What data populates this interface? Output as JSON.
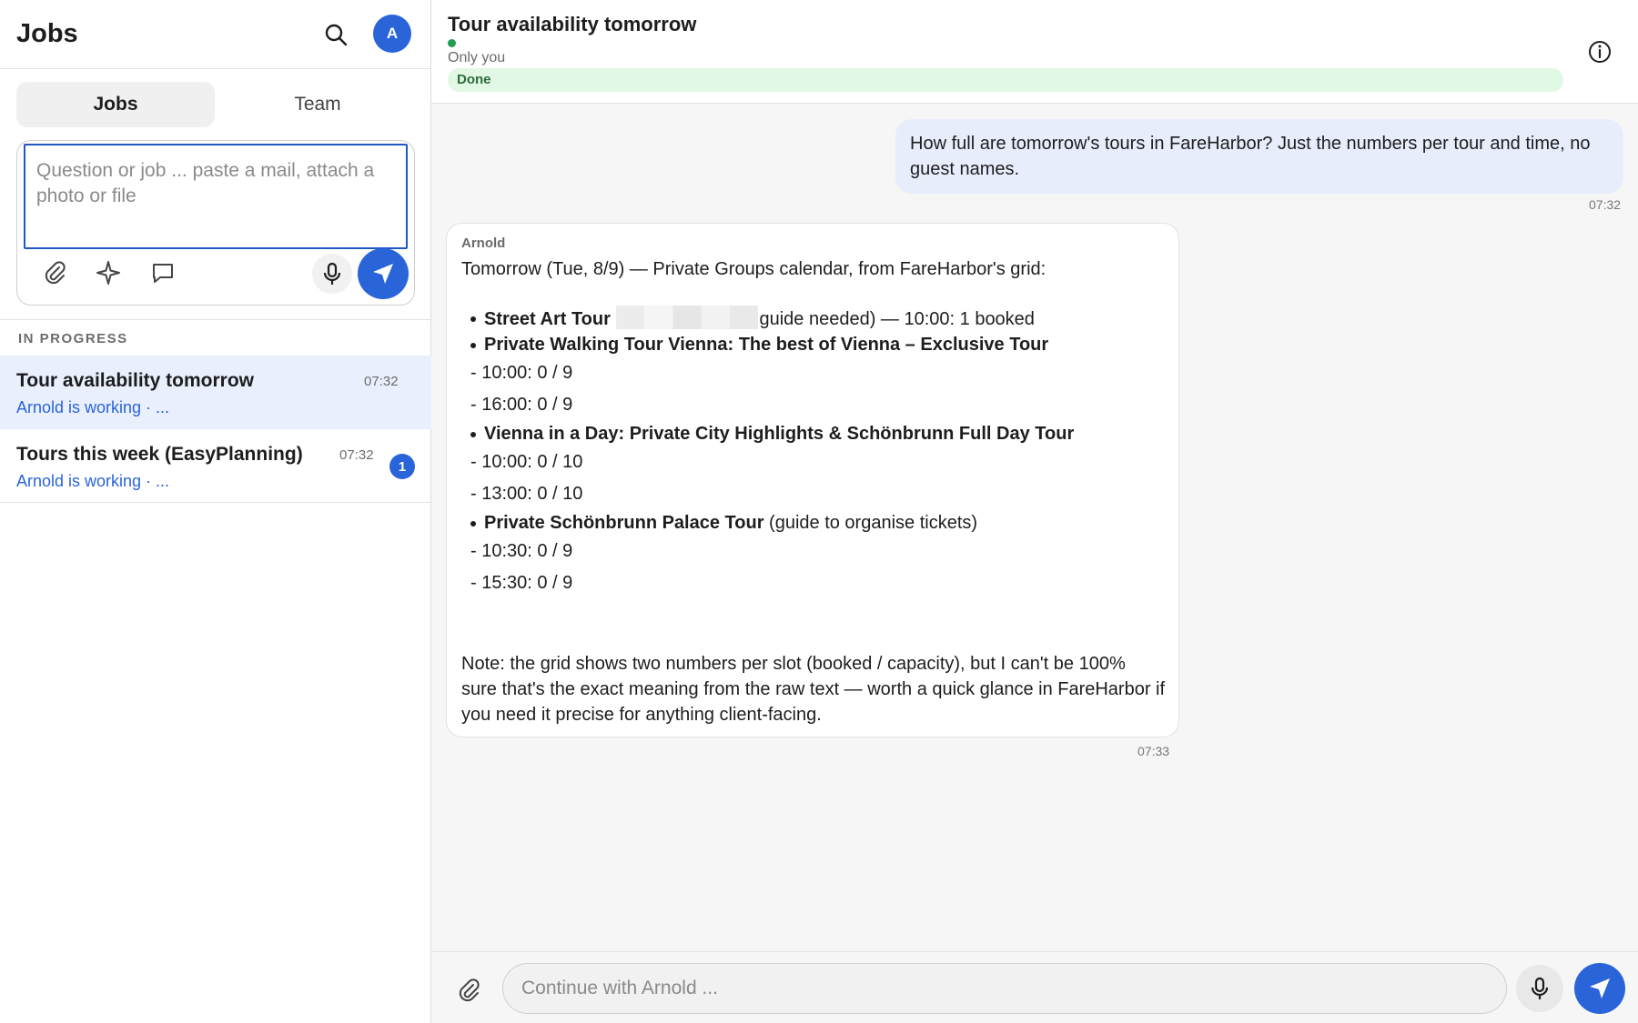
{
  "colors": {
    "accent": "#2a64d9",
    "status_green": "#1f9d55",
    "done_bar": "#e1f8e5",
    "user_bubble": "#e8edfb",
    "active_item": "#e9effd"
  },
  "sidebar": {
    "title": "Jobs",
    "search_icon": "search-icon",
    "avatar_initial": "A",
    "tabs": [
      {
        "label": "Jobs",
        "active": true
      },
      {
        "label": "Team",
        "active": false
      }
    ],
    "composer": {
      "placeholder": "Question or job ... paste a mail, attach a photo or file",
      "value": "",
      "icons": [
        "paperclip-icon",
        "sparkle-icon",
        "chat-bubble-icon",
        "microphone-icon",
        "send-icon"
      ]
    },
    "section_label": "IN PROGRESS",
    "jobs": [
      {
        "title": "Tour availability tomorrow",
        "time": "07:32",
        "status": "Arnold is working · ...",
        "active": true
      },
      {
        "title": "Tours this week (EasyPlanning)",
        "time": "07:32",
        "status": "Arnold is working · ...",
        "badge": "1",
        "active": false
      }
    ]
  },
  "conversation": {
    "title": "Tour availability tomorrow",
    "visibility": "Only you",
    "progress_label": "Done",
    "progress_fraction": 1.0,
    "info_icon": "info-icon",
    "messages": {
      "user": {
        "text": "How full are tomorrow's tours in FareHarbor? Just the numbers per tour and time, no guest names.",
        "time": "07:32"
      },
      "assistant": {
        "sender": "Arnold",
        "intro": "Tomorrow (Tue, 8/9) — Private Groups calendar, from FareHarbor's grid:",
        "tours": [
          {
            "name": "Street Art Tour",
            "suffix": "guide needed) — 10:00: 1 booked",
            "redacted": true,
            "slots": []
          },
          {
            "name": "Private Walking Tour Vienna: The best of Vienna – Exclusive Tour",
            "suffix": "",
            "slots": [
              "- 10:00: 0 / 9",
              "- 16:00: 0 / 9"
            ]
          },
          {
            "name": "Vienna in a Day: Private City Highlights & Schönbrunn Full Day Tour",
            "suffix": "",
            "slots": [
              "- 10:00: 0 / 10",
              "- 13:00: 0 / 10"
            ]
          },
          {
            "name": "Private Schönbrunn Palace Tour",
            "suffix": "(guide to organise tickets)",
            "slots": [
              "- 10:30: 0 / 9",
              "- 15:30: 0 / 9"
            ]
          }
        ],
        "note": "Note: the grid shows two numbers per slot (booked / capacity), but I can't be 100% sure that's the exact meaning from the raw text — worth a quick glance in FareHarbor if you need it precise for anything client-facing.",
        "time": "07:33"
      }
    },
    "composer": {
      "placeholder": "Continue with Arnold ...",
      "value": ""
    }
  }
}
